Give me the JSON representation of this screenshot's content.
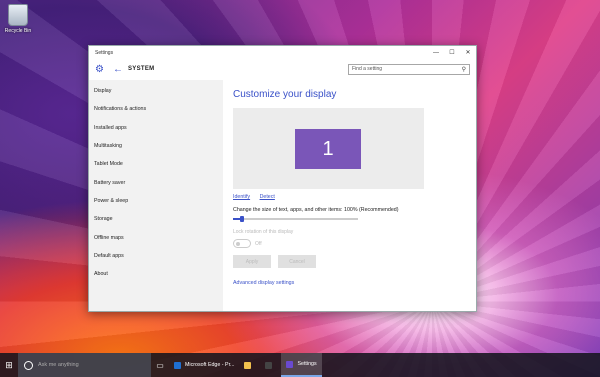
{
  "desktop": {
    "recycle_bin_label": "Recycle Bin"
  },
  "window": {
    "title": "Settings",
    "controls": {
      "minimize": "—",
      "maximize": "☐",
      "close": "✕"
    },
    "header": {
      "section": "SYSTEM",
      "search_placeholder": "Find a setting"
    }
  },
  "sidebar": {
    "items": [
      {
        "label": "Display"
      },
      {
        "label": "Notifications & actions"
      },
      {
        "label": "Installed apps"
      },
      {
        "label": "Multitasking"
      },
      {
        "label": "Tablet Mode"
      },
      {
        "label": "Battery saver"
      },
      {
        "label": "Power & sleep"
      },
      {
        "label": "Storage"
      },
      {
        "label": "Offline maps"
      },
      {
        "label": "Default apps"
      },
      {
        "label": "About"
      }
    ]
  },
  "content": {
    "heading": "Customize your display",
    "monitor_number": "1",
    "identify_link": "Identify",
    "detect_link": "Detect",
    "scale_label": "Change the size of text, apps, and other items: 100% (Recommended)",
    "scale_value": 0.07,
    "lock_rotation_label": "Lock rotation of this display",
    "toggle_state": "Off",
    "apply_label": "Apply",
    "cancel_label": "Cancel",
    "advanced_link": "Advanced display settings"
  },
  "taskbar": {
    "search_placeholder": "Ask me anything",
    "apps": [
      {
        "label": "Microsoft Edge - Pr...",
        "color": "#1f6fd1"
      },
      {
        "label": "",
        "color": "#f2c14e"
      },
      {
        "label": "",
        "color": "#444444"
      },
      {
        "label": "Settings",
        "color": "#6a4ad0"
      }
    ]
  },
  "colors": {
    "accent": "#3a51c8",
    "monitor": "#7a56b8"
  }
}
